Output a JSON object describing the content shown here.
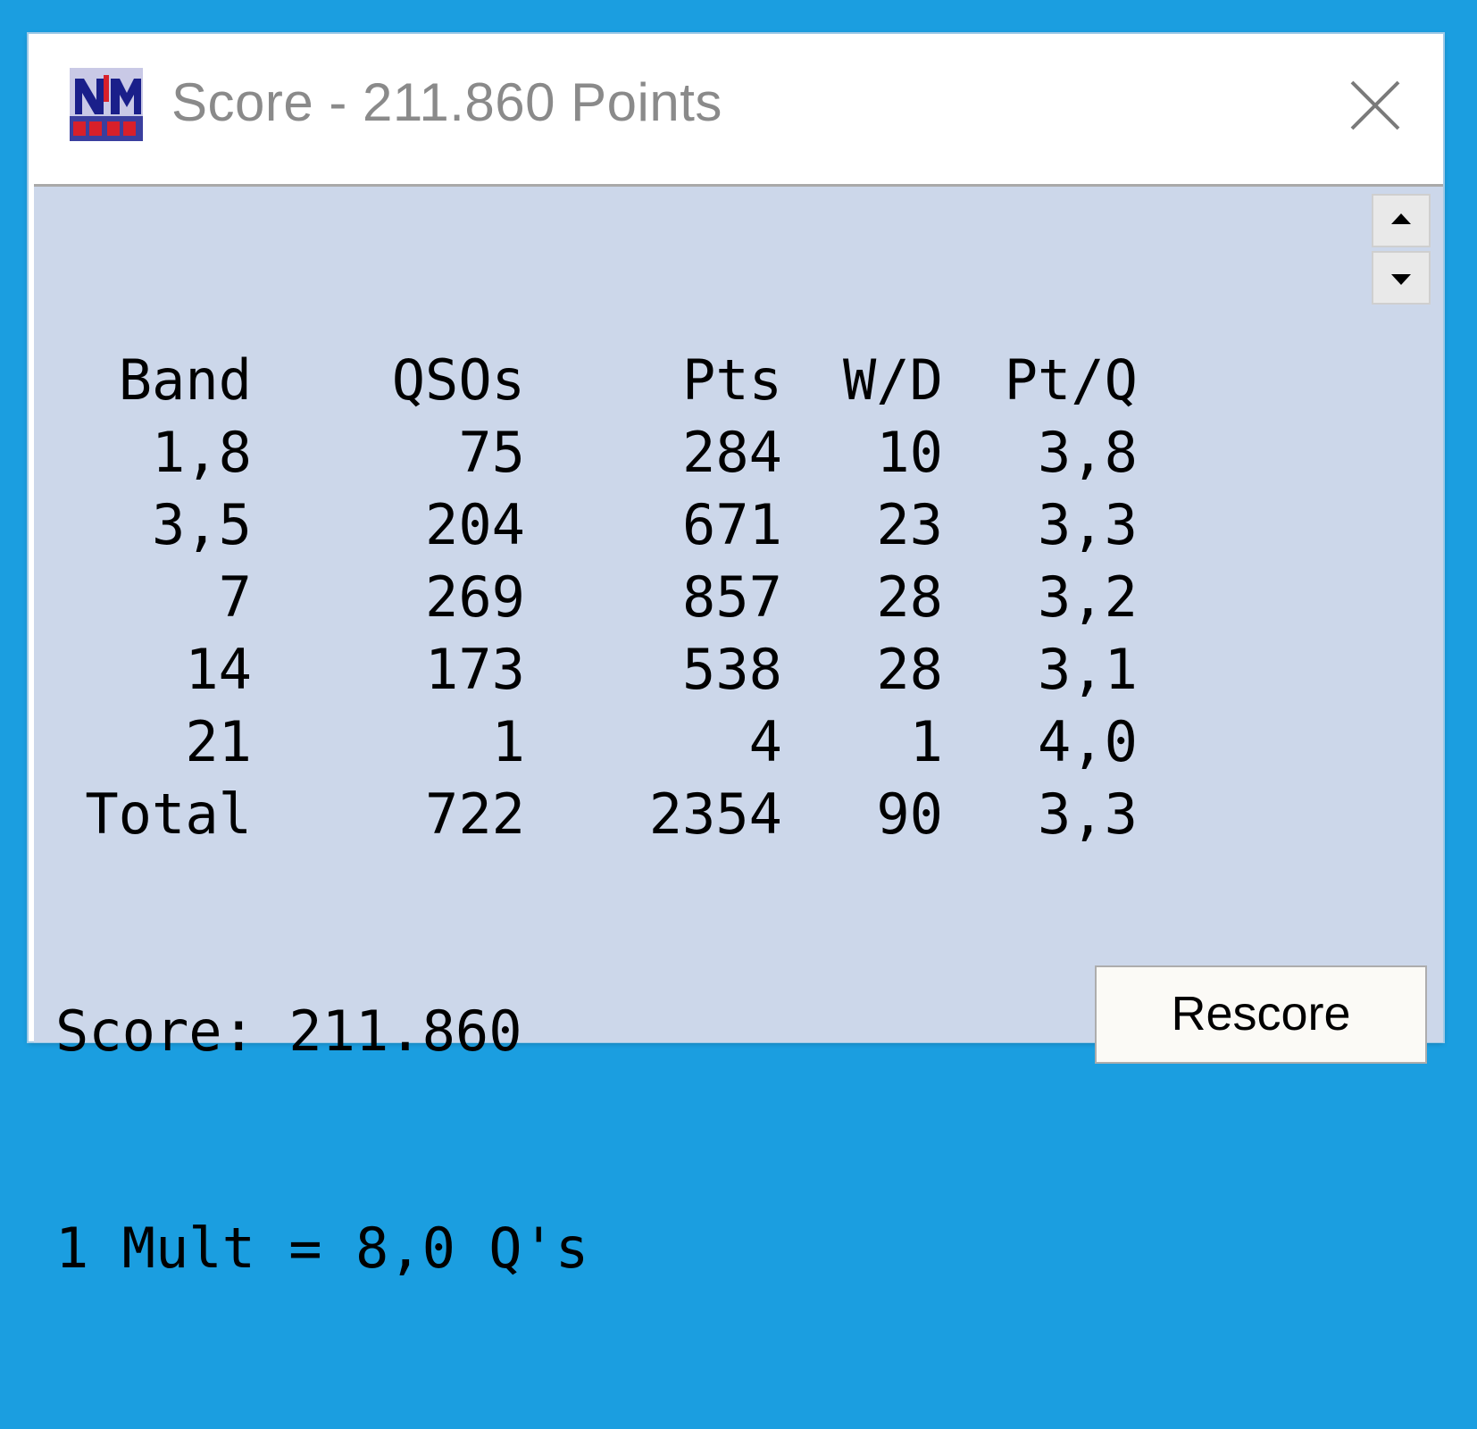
{
  "window": {
    "title": "Score - 211.860 Points",
    "icon": "n1mm-logo-icon",
    "close_icon": "close-icon"
  },
  "table": {
    "headers": [
      "Band",
      "QSOs",
      "Pts",
      "W/D",
      "Pt/Q"
    ],
    "rows": [
      [
        "1,8",
        "75",
        "284",
        "10",
        "3,8"
      ],
      [
        "3,5",
        "204",
        "671",
        "23",
        "3,3"
      ],
      [
        "7",
        "269",
        "857",
        "28",
        "3,2"
      ],
      [
        "14",
        "173",
        "538",
        "28",
        "3,1"
      ],
      [
        "21",
        "1",
        "4",
        "1",
        "4,0"
      ],
      [
        "Total",
        "722",
        "2354",
        "90",
        "3,3"
      ]
    ]
  },
  "summary": {
    "score_line": "Score: 211.860",
    "mult_line": "1 Mult = 8,0 Q's"
  },
  "buttons": {
    "rescore": "Rescore"
  },
  "scrollbar": {
    "up_icon": "scroll-up-arrow-icon",
    "down_icon": "scroll-down-arrow-icon"
  },
  "colors": {
    "client_bg": "#ccd7ea",
    "desktop_bg": "#1b9ee0"
  }
}
